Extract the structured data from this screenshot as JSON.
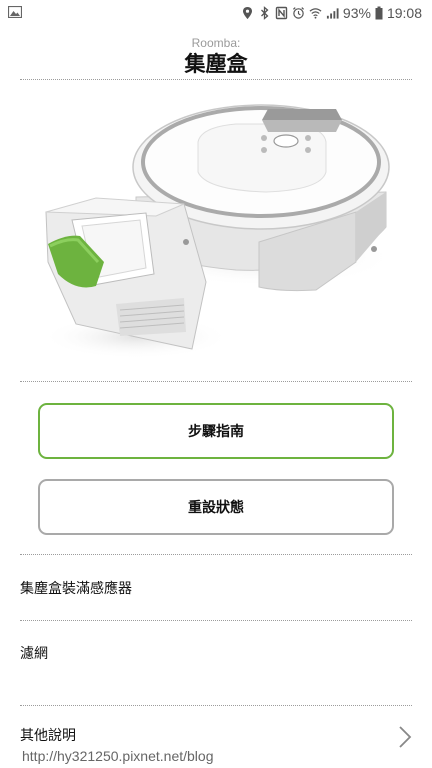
{
  "status_bar": {
    "battery_percent": "93%",
    "time": "19:08",
    "icons": [
      "gallery-icon",
      "location-icon",
      "bluetooth-icon",
      "nfc-icon",
      "alarm-icon",
      "wifi-icon",
      "signal-icon",
      "battery-icon"
    ]
  },
  "header": {
    "subtitle": "Roomba:",
    "title": "集塵盒"
  },
  "product_image": {
    "accent_color": "#6db33f"
  },
  "buttons": {
    "guide_label": "步驟指南",
    "reset_label": "重設狀態"
  },
  "list": {
    "items": [
      {
        "label": "集塵盒裝滿感應器"
      },
      {
        "label": "濾網"
      },
      {
        "label": "其他說明"
      }
    ]
  },
  "watermark": "http://hy321250.pixnet.net/blog",
  "colors": {
    "accent_green": "#6db33f",
    "border_gray": "#a9a9a9",
    "divider": "#9c9c9c"
  }
}
